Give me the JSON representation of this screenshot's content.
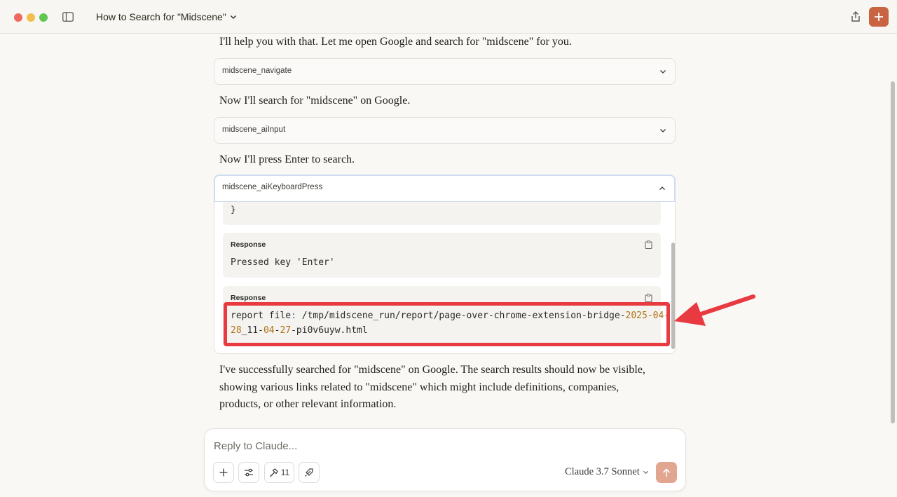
{
  "window": {
    "title": "How to Search for \"Midscene\""
  },
  "conversation": {
    "msg1": "I'll help you with that. Let me open Google and search for \"midscene\" for you.",
    "tool1": "midscene_navigate",
    "msg2": "Now I'll search for \"midscene\" on Google.",
    "tool2": "midscene_aiInput",
    "msg3": "Now I'll press Enter to search.",
    "tool3": "midscene_aiKeyboardPress",
    "code_tail": "}",
    "response1": {
      "label": "Response",
      "text": "Pressed key 'Enter'"
    },
    "response2": {
      "label": "Response",
      "line1_prefix": "report file",
      "line1_colon": ":",
      "line1_path": " /tmp/midscene_run/report/page-over-chrome-extension-bridge-",
      "line1_date": "2025-04-",
      "line2_a": "28",
      "line2_b": "_11-",
      "line2_c": "04",
      "line2_d": "-",
      "line2_e": "27",
      "line2_f": "-pi0v6uyw.html"
    },
    "msg4_line1": "I've successfully searched for \"midscene\" on Google. The search results should now be visible,",
    "msg4_line2": "showing various links related to \"midscene\" which might include definitions, companies,",
    "msg4_line3": "products, or other relevant information."
  },
  "composer": {
    "placeholder": "Reply to Claude...",
    "tools_count": "11",
    "model": "Claude 3.7 Sonnet"
  },
  "colors": {
    "accent": "#c96442",
    "highlight": "#e83a40",
    "send_disabled": "#e2a58f"
  },
  "icons": [
    "sidebar-icon",
    "chevron-down-icon",
    "share-icon",
    "plus-icon",
    "chevron-up-icon",
    "clipboard-icon",
    "sliders-icon",
    "hammer-icon",
    "rocket-icon",
    "arrow-up-icon"
  ]
}
